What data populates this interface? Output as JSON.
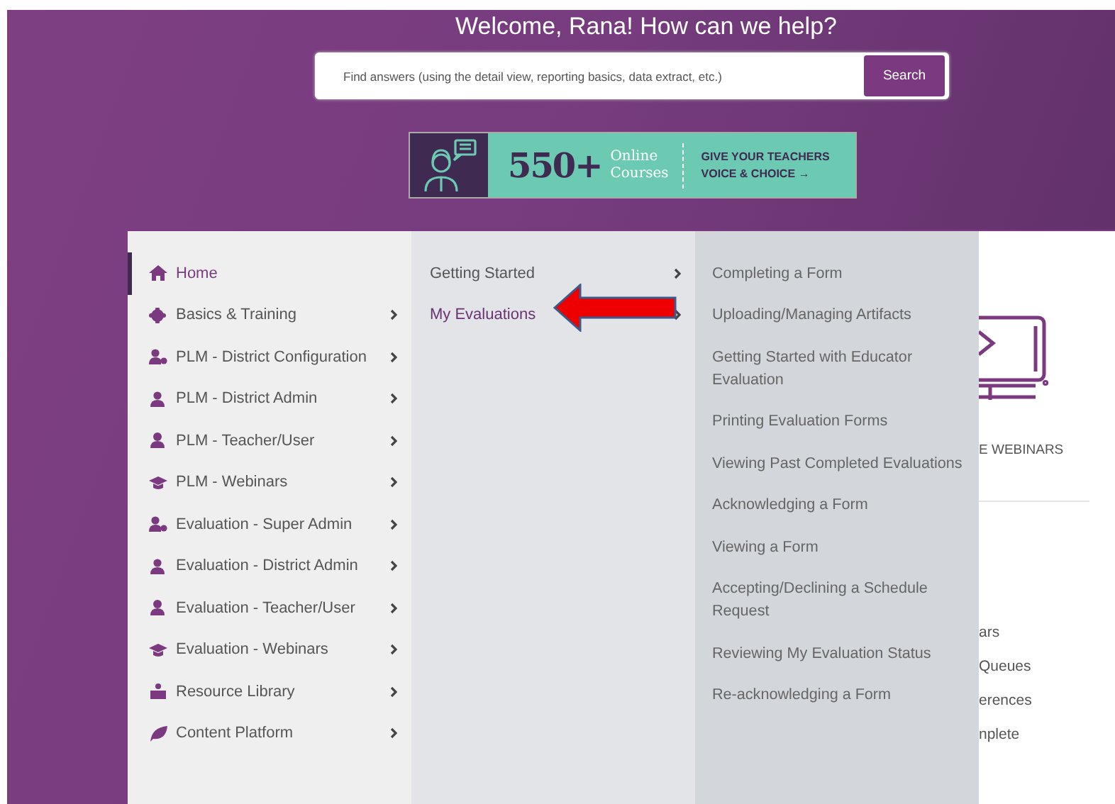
{
  "hero": {
    "heading": "Welcome, Rana! How can we help?",
    "search": {
      "placeholder": "Find answers (using the detail view, reporting basics, data extract, etc.)",
      "button": "Search"
    },
    "banner": {
      "count": "550+",
      "line_1": "Online",
      "line_2": "Courses",
      "cta_1": "GIVE YOUR TEACHERS",
      "cta_2": "VOICE & CHOICE",
      "cta_arrow": "→"
    }
  },
  "menu": {
    "level_1": [
      {
        "label": "Home",
        "selected": true,
        "has_submenu": false
      },
      {
        "label": "Basics & Training",
        "selected": false,
        "has_submenu": true
      },
      {
        "label": "PLM - District Configuration",
        "selected": false,
        "has_submenu": true
      },
      {
        "label": "PLM - District Admin",
        "selected": false,
        "has_submenu": true
      },
      {
        "label": "PLM - Teacher/User",
        "selected": false,
        "has_submenu": true
      },
      {
        "label": "PLM - Webinars",
        "selected": false,
        "has_submenu": true
      },
      {
        "label": "Evaluation - Super Admin",
        "selected": false,
        "has_submenu": true
      },
      {
        "label": "Evaluation - District Admin",
        "selected": false,
        "has_submenu": true
      },
      {
        "label": "Evaluation - Teacher/User",
        "selected": false,
        "has_submenu": true
      },
      {
        "label": "Evaluation - Webinars",
        "selected": false,
        "has_submenu": true
      },
      {
        "label": "Resource Library",
        "selected": false,
        "has_submenu": true
      },
      {
        "label": "Content Platform",
        "selected": false,
        "has_submenu": true
      }
    ],
    "level_2": [
      {
        "label": "Getting Started",
        "selected": false,
        "has_submenu": true
      },
      {
        "label": "My Evaluations",
        "selected": true,
        "has_submenu": true
      }
    ],
    "level_3": [
      {
        "label": "Completing a Form"
      },
      {
        "label": "Uploading/Managing Artifacts"
      },
      {
        "label": "Getting Started with Educator Evaluation"
      },
      {
        "label": "Printing Evaluation Forms"
      },
      {
        "label": "Viewing Past Completed Evaluations"
      },
      {
        "label": "Acknowledging a Form"
      },
      {
        "label": "Viewing a Form"
      },
      {
        "label": "Accepting/Declining a Schedule Request"
      },
      {
        "label": "Reviewing My Evaluation Status"
      },
      {
        "label": "Re-acknowledging a Form"
      }
    ]
  },
  "background_content": {
    "card_title": "E WEBINARS",
    "links": [
      "ars",
      "Queues",
      "erences",
      "nplete"
    ]
  }
}
